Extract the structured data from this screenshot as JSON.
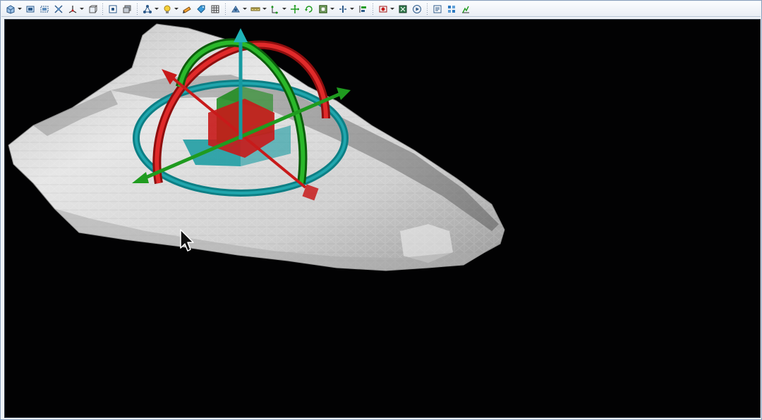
{
  "toolbar": {
    "groups": [
      [
        {
          "icon": "view-cube-icon",
          "dropdown": true
        },
        {
          "icon": "zoom-fit-icon",
          "dropdown": false
        },
        {
          "icon": "zoom-window-icon",
          "dropdown": false
        },
        {
          "icon": "zoom-extents-icon",
          "dropdown": false
        },
        {
          "icon": "axes-view-icon",
          "dropdown": true
        },
        {
          "icon": "box-view-icon",
          "dropdown": false
        }
      ],
      [
        {
          "icon": "select-icon",
          "dropdown": false
        },
        {
          "icon": "layers-icon",
          "dropdown": false
        }
      ],
      [
        {
          "icon": "network-icon",
          "dropdown": true
        },
        {
          "icon": "light-icon",
          "dropdown": true
        },
        {
          "icon": "pencil-icon",
          "dropdown": false
        },
        {
          "icon": "tag-icon",
          "dropdown": false
        },
        {
          "icon": "grid-icon",
          "dropdown": false
        }
      ],
      [
        {
          "icon": "mesh-tool-icon",
          "dropdown": true
        },
        {
          "icon": "measure-icon",
          "dropdown": true
        },
        {
          "icon": "snap-icon",
          "dropdown": true
        },
        {
          "icon": "transform-icon",
          "dropdown": false
        },
        {
          "icon": "rotate-icon",
          "dropdown": false
        },
        {
          "icon": "frame-icon",
          "dropdown": true
        },
        {
          "icon": "split-icon",
          "dropdown": true
        },
        {
          "icon": "align-icon",
          "dropdown": false
        }
      ],
      [
        {
          "icon": "record-icon",
          "dropdown": true
        },
        {
          "icon": "render-icon",
          "dropdown": false
        },
        {
          "icon": "play-icon",
          "dropdown": false
        }
      ],
      [
        {
          "icon": "properties-icon",
          "dropdown": false
        },
        {
          "icon": "panels-icon",
          "dropdown": false
        },
        {
          "icon": "chart-icon",
          "dropdown": false
        }
      ]
    ]
  },
  "viewport": {
    "background": "#020203",
    "mesh_color": "#d9d9d9",
    "gizmo": {
      "x_axis_color": "#c81a1a",
      "y_axis_color": "#1a9a1a",
      "z_axis_color": "#159aa0"
    }
  }
}
